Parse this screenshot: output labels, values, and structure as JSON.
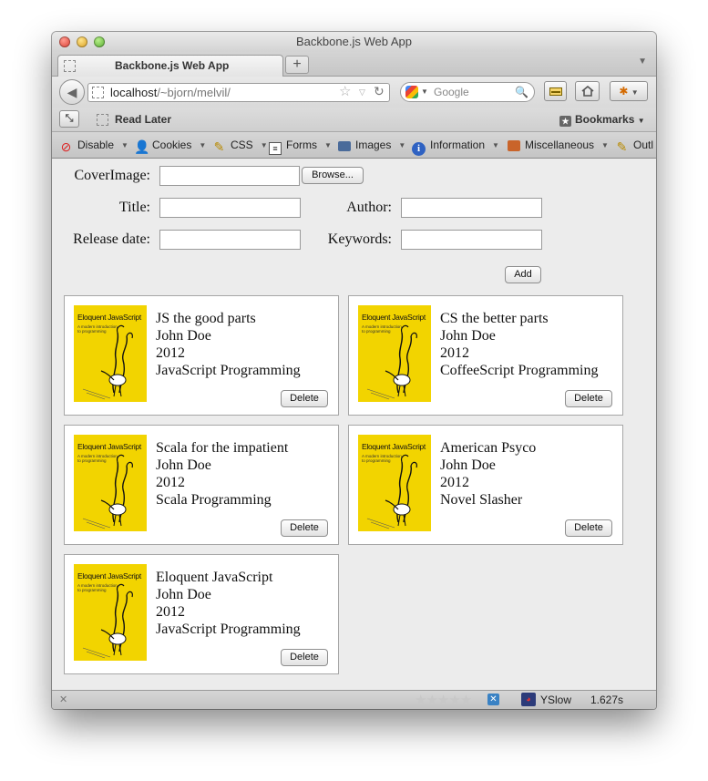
{
  "window": {
    "title": "Backbone.js Web App",
    "tab_title": "Backbone.js Web App",
    "newtab_label": "+"
  },
  "navbar": {
    "url_host": "localhost",
    "url_path": "/~bjorn/melvil/",
    "search_placeholder": "Google"
  },
  "bookmarks_bar": {
    "read_later": "Read Later",
    "bookmarks": "Bookmarks"
  },
  "devbar": {
    "items": [
      {
        "label": "Disable",
        "icon": "disable-icon"
      },
      {
        "label": "Cookies",
        "icon": "cookies-icon"
      },
      {
        "label": "CSS",
        "icon": "css-icon"
      },
      {
        "label": "Forms",
        "icon": "forms-icon"
      },
      {
        "label": "Images",
        "icon": "images-icon"
      },
      {
        "label": "Information",
        "icon": "information-icon"
      },
      {
        "label": "Miscellaneous",
        "icon": "miscellaneous-icon"
      },
      {
        "label": "Outl",
        "icon": "outline-icon"
      }
    ]
  },
  "form": {
    "cover_label": "CoverImage:",
    "browse_label": "Browse...",
    "title_label": "Title:",
    "author_label": "Author:",
    "release_label": "Release date:",
    "keywords_label": "Keywords:",
    "add_label": "Add"
  },
  "cover": {
    "title": "Eloquent JavaScript",
    "subtitle_1": "A modern introduction",
    "subtitle_2": "to programming"
  },
  "books": [
    {
      "title": "JS the good parts",
      "author": "John Doe",
      "year": "2012",
      "keywords": "JavaScript Programming",
      "delete_label": "Delete"
    },
    {
      "title": "CS the better parts",
      "author": "John Doe",
      "year": "2012",
      "keywords": "CoffeeScript Programming",
      "delete_label": "Delete"
    },
    {
      "title": "Scala for the impatient",
      "author": "John Doe",
      "year": "2012",
      "keywords": "Scala Programming",
      "delete_label": "Delete"
    },
    {
      "title": "American Psyco",
      "author": "John Doe",
      "year": "2012",
      "keywords": "Novel Slasher",
      "delete_label": "Delete"
    },
    {
      "title": "Eloquent JavaScript",
      "author": "John Doe",
      "year": "2012",
      "keywords": "JavaScript Programming",
      "delete_label": "Delete"
    }
  ],
  "statusbar": {
    "yslow_label": "YSlow",
    "load_time": "1.627s"
  }
}
